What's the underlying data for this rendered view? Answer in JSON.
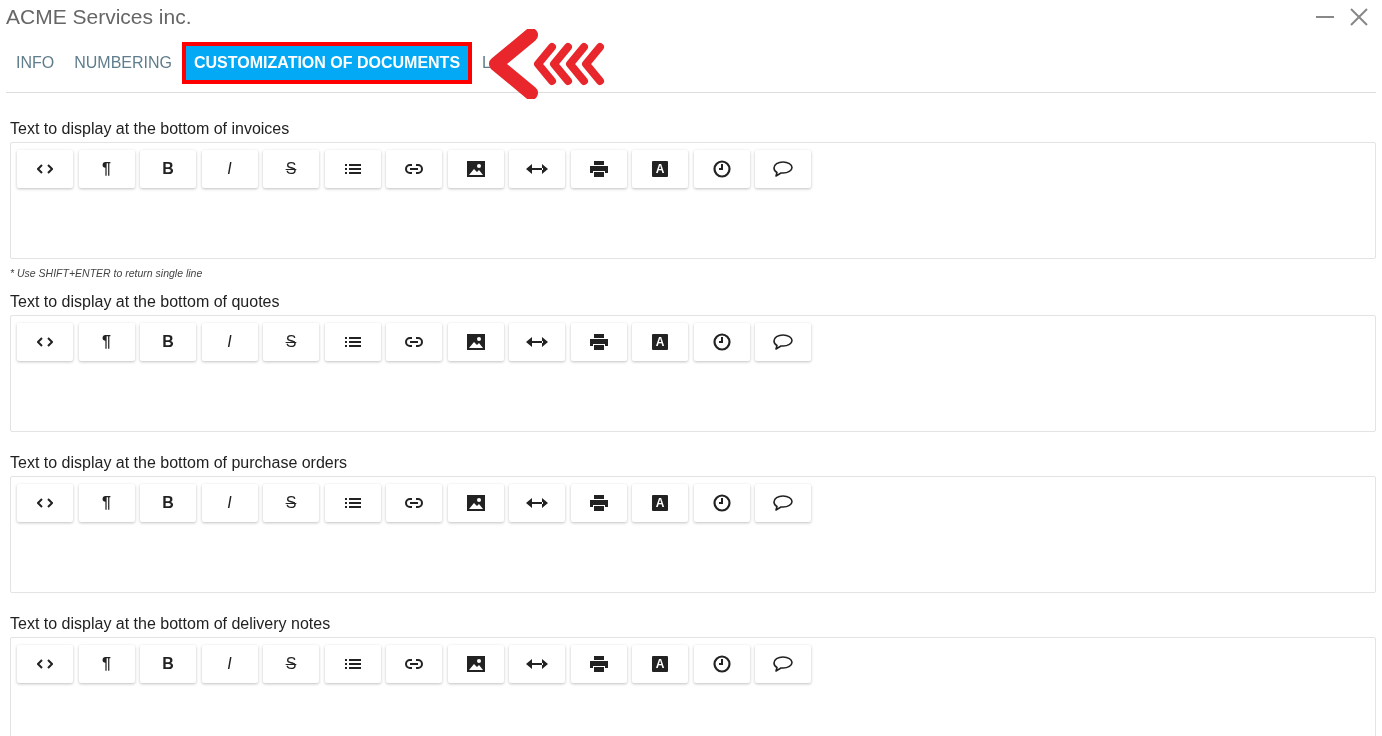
{
  "window": {
    "title": "ACME Services inc."
  },
  "tabs": [
    {
      "label": "INFO",
      "selected": false,
      "highlighted": false
    },
    {
      "label": "NUMBERING",
      "selected": false,
      "highlighted": false
    },
    {
      "label": "CUSTOMIZATION OF DOCUMENTS",
      "selected": true,
      "highlighted": true
    },
    {
      "label": "L",
      "selected": false,
      "highlighted": false
    }
  ],
  "pointer_arrow": true,
  "editors": [
    {
      "label": "Text to display at the bottom of invoices",
      "hint": "* Use SHIFT+ENTER to return single line",
      "toolbar": [
        {
          "kind": "code"
        },
        {
          "kind": "glyph",
          "glyph": "¶"
        },
        {
          "kind": "glyph",
          "glyph": "B"
        },
        {
          "kind": "italic",
          "glyph": "I"
        },
        {
          "kind": "strike",
          "glyph": "S"
        },
        {
          "kind": "list"
        },
        {
          "kind": "link"
        },
        {
          "kind": "image"
        },
        {
          "kind": "width"
        },
        {
          "kind": "print"
        },
        {
          "kind": "font",
          "glyph": "A"
        },
        {
          "kind": "clock"
        },
        {
          "kind": "comment"
        }
      ]
    },
    {
      "label": "Text to display at the bottom of quotes",
      "toolbar": [
        {
          "kind": "code"
        },
        {
          "kind": "glyph",
          "glyph": "¶"
        },
        {
          "kind": "glyph",
          "glyph": "B"
        },
        {
          "kind": "italic",
          "glyph": "I"
        },
        {
          "kind": "strike",
          "glyph": "S"
        },
        {
          "kind": "list"
        },
        {
          "kind": "link"
        },
        {
          "kind": "image"
        },
        {
          "kind": "width"
        },
        {
          "kind": "print"
        },
        {
          "kind": "font",
          "glyph": "A"
        },
        {
          "kind": "clock"
        },
        {
          "kind": "comment"
        }
      ]
    },
    {
      "label": "Text to display at the bottom of purchase orders",
      "toolbar": [
        {
          "kind": "code"
        },
        {
          "kind": "glyph",
          "glyph": "¶"
        },
        {
          "kind": "glyph",
          "glyph": "B"
        },
        {
          "kind": "italic",
          "glyph": "I"
        },
        {
          "kind": "strike",
          "glyph": "S"
        },
        {
          "kind": "list"
        },
        {
          "kind": "link"
        },
        {
          "kind": "image"
        },
        {
          "kind": "width"
        },
        {
          "kind": "print"
        },
        {
          "kind": "font",
          "glyph": "A"
        },
        {
          "kind": "clock"
        },
        {
          "kind": "comment"
        }
      ]
    },
    {
      "label": "Text to display at the bottom of delivery notes",
      "toolbar": [
        {
          "kind": "code"
        },
        {
          "kind": "glyph",
          "glyph": "¶"
        },
        {
          "kind": "glyph",
          "glyph": "B"
        },
        {
          "kind": "italic",
          "glyph": "I"
        },
        {
          "kind": "strike",
          "glyph": "S"
        },
        {
          "kind": "list"
        },
        {
          "kind": "link"
        },
        {
          "kind": "image"
        },
        {
          "kind": "width"
        },
        {
          "kind": "print"
        },
        {
          "kind": "font",
          "glyph": "A"
        },
        {
          "kind": "clock"
        },
        {
          "kind": "comment"
        }
      ]
    }
  ]
}
